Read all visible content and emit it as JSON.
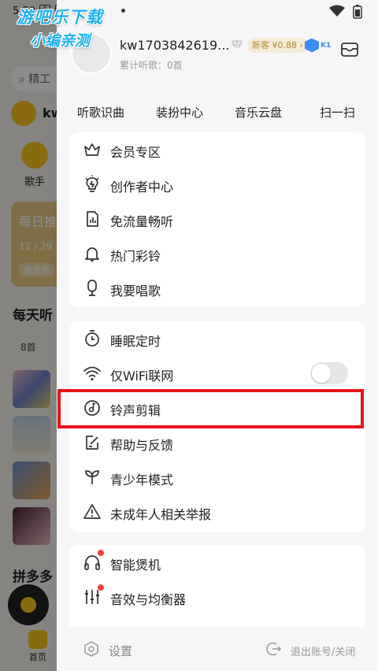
{
  "watermark": {
    "line1": "游吧乐下载",
    "line2": "小编亲测"
  },
  "background": {
    "status_time": "5:20",
    "status_icon_1": "A",
    "search_placeholder": "精工",
    "user_short": "kw",
    "category_label": "歌手",
    "daily_title": "每日推",
    "daily_date": "12 / 29",
    "daily_tag": "免费听",
    "section_title": "每天听",
    "count_label": "8首",
    "section2_title": "拼多多",
    "tab_home": "首页",
    "accent_color": "#f7c31a"
  },
  "drawer": {
    "profile": {
      "username": "kw1703842619...",
      "listen_label": "累计听歌：0首",
      "new_badge": "新客 ¥0.88 ›",
      "level": "K1"
    },
    "quick_actions": [
      "听歌识曲",
      "装扮中心",
      "音乐云盘",
      "扫一扫"
    ],
    "menu_group_1": [
      {
        "label": "会员专区",
        "icon": "crown-icon"
      },
      {
        "label": "创作者中心",
        "icon": "lightbulb-icon"
      },
      {
        "label": "免流量畅听",
        "icon": "data-card-icon"
      },
      {
        "label": "热门彩铃",
        "icon": "bell-icon"
      },
      {
        "label": "我要唱歌",
        "icon": "microphone-icon"
      }
    ],
    "menu_group_2": [
      {
        "label": "睡眠定时",
        "icon": "timer-icon"
      },
      {
        "label": "仅WiFi联网",
        "icon": "wifi-icon",
        "toggle": false
      },
      {
        "label": "铃声剪辑",
        "icon": "ringtone-icon"
      },
      {
        "label": "帮助与反馈",
        "icon": "edit-icon"
      },
      {
        "label": "青少年模式",
        "icon": "sprout-icon"
      },
      {
        "label": "未成年人相关举报",
        "icon": "warning-icon"
      }
    ],
    "menu_group_3": [
      {
        "label": "智能煲机",
        "icon": "headphones-icon",
        "badge": true
      },
      {
        "label": "音效与均衡器",
        "icon": "equalizer-icon",
        "badge": true
      }
    ],
    "bottom": {
      "settings_label": "设置",
      "logout_label": "退出账号/关闭"
    },
    "highlight_color": "#e8141b"
  }
}
